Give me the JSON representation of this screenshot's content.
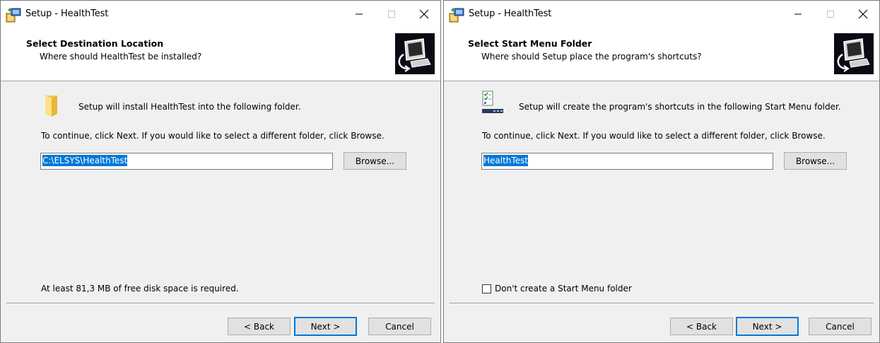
{
  "left": {
    "window_title": "Setup - HealthTest",
    "header_title": "Select Destination Location",
    "header_subtitle": "Where should HealthTest be installed?",
    "info_text": "Setup will install HealthTest into the following folder.",
    "continue_text": "To continue, click Next. If you would like to select a different folder, click Browse.",
    "path_value": "C:\\ELSYS\\HealthTest",
    "browse_label": "Browse...",
    "disk_text": "At least 81,3 MB of free disk space is required.",
    "back_label": "< Back",
    "next_label": "Next >",
    "cancel_label": "Cancel"
  },
  "right": {
    "window_title": "Setup - HealthTest",
    "header_title": "Select Start Menu Folder",
    "header_subtitle": "Where should Setup place the program's shortcuts?",
    "info_text": "Setup will create the program's shortcuts in the following Start Menu folder.",
    "continue_text": "To continue, click Next. If you would like to select a different folder, click Browse.",
    "folder_value": "HealthTest",
    "browse_label": "Browse...",
    "checkbox_label": "Don't create a Start Menu folder",
    "checkbox_checked": false,
    "back_label": "< Back",
    "next_label": "Next >",
    "cancel_label": "Cancel"
  },
  "colors": {
    "selection": "#0078d7",
    "dialog_bg": "#f0f0f0",
    "button_bg": "#e1e1e1"
  },
  "icons": [
    "setup-app-icon",
    "minimize-icon",
    "maximize-icon",
    "close-icon",
    "computer-setup-icon",
    "folder-icon",
    "start-menu-folder-icon"
  ]
}
